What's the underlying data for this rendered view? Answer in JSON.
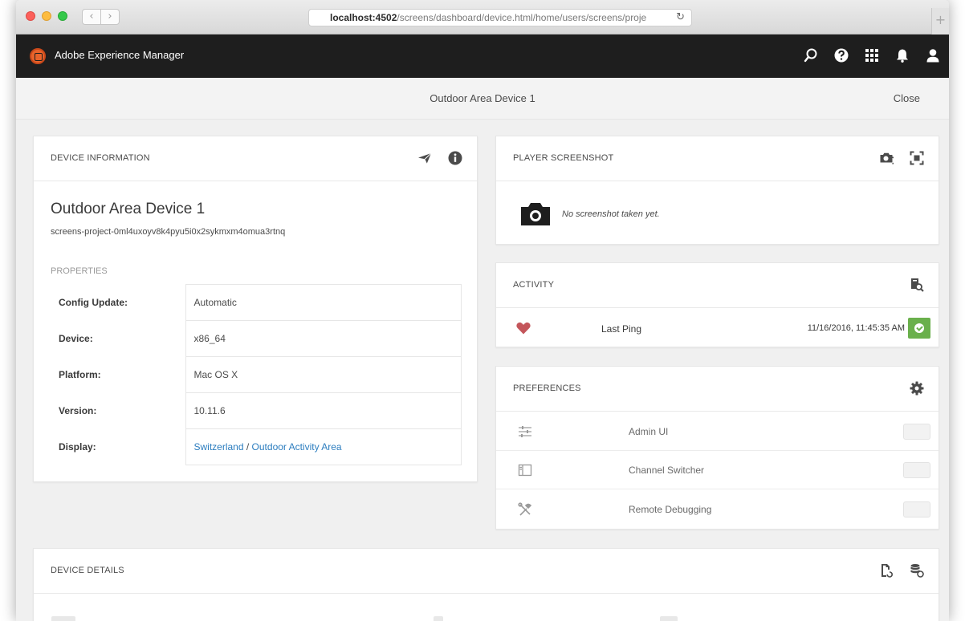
{
  "browser": {
    "url_host": "localhost:4502",
    "url_path": "/screens/dashboard/device.html/home/users/screens/projе",
    "back_glyph": "‹",
    "forward_glyph": "›",
    "reload_glyph": "↻",
    "new_tab_glyph": "+"
  },
  "shell": {
    "title": "Adobe Experience Manager",
    "icons": [
      "search-icon",
      "help-icon",
      "apps-icon",
      "notifications-icon",
      "user-icon"
    ]
  },
  "header": {
    "title": "Outdoor Area Device 1",
    "close_label": "Close"
  },
  "device_info": {
    "title": "DEVICE INFORMATION",
    "name": "Outdoor Area Device 1",
    "id": "screens-project-0ml4uxoyv8k4pyu5i0x2sykmxm4omua3rtnq",
    "properties_label": "PROPERTIES",
    "properties": [
      {
        "key": "Config Update:",
        "value": "Automatic"
      },
      {
        "key": "Device:",
        "value": "x86_64"
      },
      {
        "key": "Platform:",
        "value": "Mac OS X"
      },
      {
        "key": "Version:",
        "value": "10.11.6"
      }
    ],
    "display": {
      "key": "Display:",
      "link1": "Switzerland",
      "separator": " / ",
      "link2": "Outdoor Activity Area"
    }
  },
  "player_screenshot": {
    "title": "PLAYER SCREENSHOT",
    "empty_text": "No screenshot taken yet."
  },
  "activity": {
    "title": "ACTIVITY",
    "ping_label": "Last Ping",
    "ping_time": "11/16/2016, 11:45:35 AM"
  },
  "preferences": {
    "title": "PREFERENCES",
    "items": [
      {
        "label": "Admin UI"
      },
      {
        "label": "Channel Switcher"
      },
      {
        "label": "Remote Debugging"
      }
    ]
  },
  "device_details": {
    "title": "DEVICE DETAILS"
  },
  "colors": {
    "accent_orange": "#e8632b",
    "link_blue": "#2c7dbf",
    "heart_red": "#c4565b",
    "ok_green": "#6ab04c",
    "shell_bg": "#1e1e1e"
  }
}
